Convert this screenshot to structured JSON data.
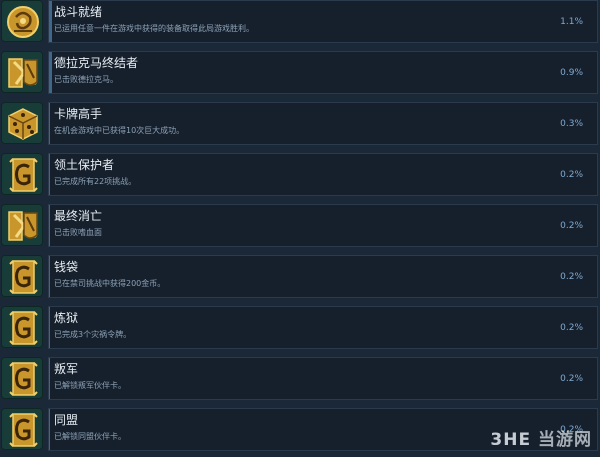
{
  "achievements": [
    {
      "name": "战斗就绪",
      "description": "已运用任意一件在游戏中获得的装备取得此局游戏胜利。",
      "percent": "1.1%",
      "percent_value": 1.1,
      "icon": "gold-emblem-icon"
    },
    {
      "name": "德拉克马终结者",
      "description": "已击败德拉克马。",
      "percent": "0.9%",
      "percent_value": 0.9,
      "icon": "swords-shield-icon"
    },
    {
      "name": "卡牌高手",
      "description": "在机会游戏中已获得10次巨大成功。",
      "percent": "0.3%",
      "percent_value": 0.3,
      "icon": "dice-icon"
    },
    {
      "name": "领土保护者",
      "description": "已完成所有22项挑战。",
      "percent": "0.2%",
      "percent_value": 0.2,
      "icon": "gold-card-icon"
    },
    {
      "name": "最终消亡",
      "description": "已击败嗜血面",
      "percent": "0.2%",
      "percent_value": 0.2,
      "icon": "swords-shield-icon"
    },
    {
      "name": "钱袋",
      "description": "已在禁司挑战中获得200金币。",
      "percent": "0.2%",
      "percent_value": 0.2,
      "icon": "gold-card-icon"
    },
    {
      "name": "炼狱",
      "description": "已完成3个灾祸令牌。",
      "percent": "0.2%",
      "percent_value": 0.2,
      "icon": "gold-card-icon"
    },
    {
      "name": "叛军",
      "description": "已解锁叛军伙伴卡。",
      "percent": "0.2%",
      "percent_value": 0.2,
      "icon": "gold-card-icon"
    },
    {
      "name": "同盟",
      "description": "已解锁同盟伙伴卡。",
      "percent": "0.2%",
      "percent_value": 0.2,
      "icon": "gold-card-icon"
    }
  ],
  "watermark": {
    "logo": "3HE",
    "text": "当游网"
  }
}
